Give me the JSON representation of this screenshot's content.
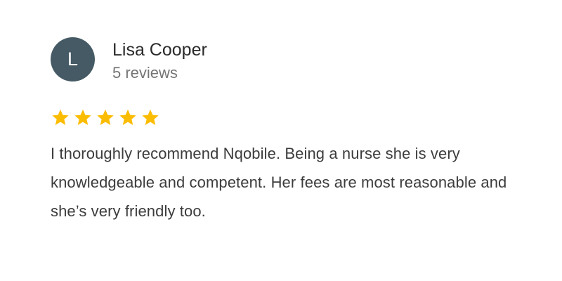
{
  "review": {
    "avatar_initial": "L",
    "avatar_color": "#455a64",
    "reviewer_name": "Lisa Cooper",
    "review_count": "5 reviews",
    "rating": 5,
    "rating_max": 5,
    "star_color": "#fbbc04",
    "star_icon": "star-icon",
    "text": "I thoroughly recommend Nqobile. Being a nurse she is very knowledgeable and competent. Her fees are most reasonable and she’s very friendly too."
  }
}
